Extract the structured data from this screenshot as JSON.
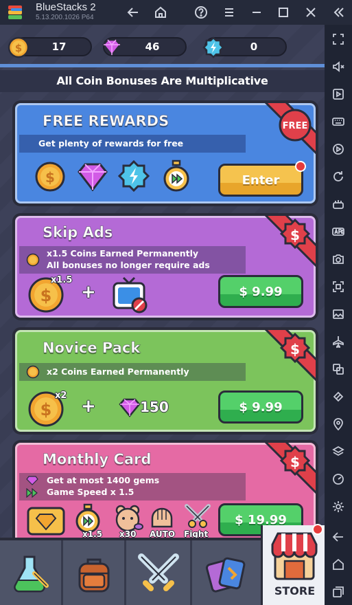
{
  "titlebar": {
    "app_name": "BlueStacks 2",
    "version": "5.13.200.1026  P64"
  },
  "currency": {
    "coins": "17",
    "gems": "46",
    "energy": "0"
  },
  "banner": "All Coin Bonuses Are Multiplicative",
  "cards": {
    "free_rewards": {
      "title": "FREE REWARDS",
      "subtitle": "Get plenty of rewards for free",
      "ribbon": "FREE",
      "button": "Enter"
    },
    "skip_ads": {
      "title": "Skip Ads",
      "line1": "x1.5 Coins Earned Permanently",
      "line2": "All bonuses no longer require ads",
      "multiplier": "x1.5",
      "plus": "+",
      "ribbon": "$",
      "price": "$ 9.99"
    },
    "novice_pack": {
      "title": "Novice Pack",
      "line1": "x2 Coins Earned Permanently",
      "multiplier": "x2",
      "plus": "+",
      "gems": "150",
      "ribbon": "$",
      "price": "$ 9.99"
    },
    "monthly_card": {
      "title": "Monthly Card",
      "line1": "Get at most 1400 gems",
      "line2": "Game Speed x 1.5",
      "speed_label": "x1.5",
      "ad_label": "x30",
      "auto_label": "AUTO",
      "fight_label": "Fight",
      "ribbon": "$",
      "price": "$ 19.99"
    }
  },
  "nav": {
    "store_label": "STORE"
  },
  "colors": {
    "free_card": "#4a86e0",
    "skip_card": "#b46ad6",
    "novice_card": "#7cc45c",
    "monthly_card": "#e56aa4",
    "button_green": "#3fbf5a",
    "button_orange": "#f0b23a",
    "ribbon_red": "#e0404a"
  }
}
